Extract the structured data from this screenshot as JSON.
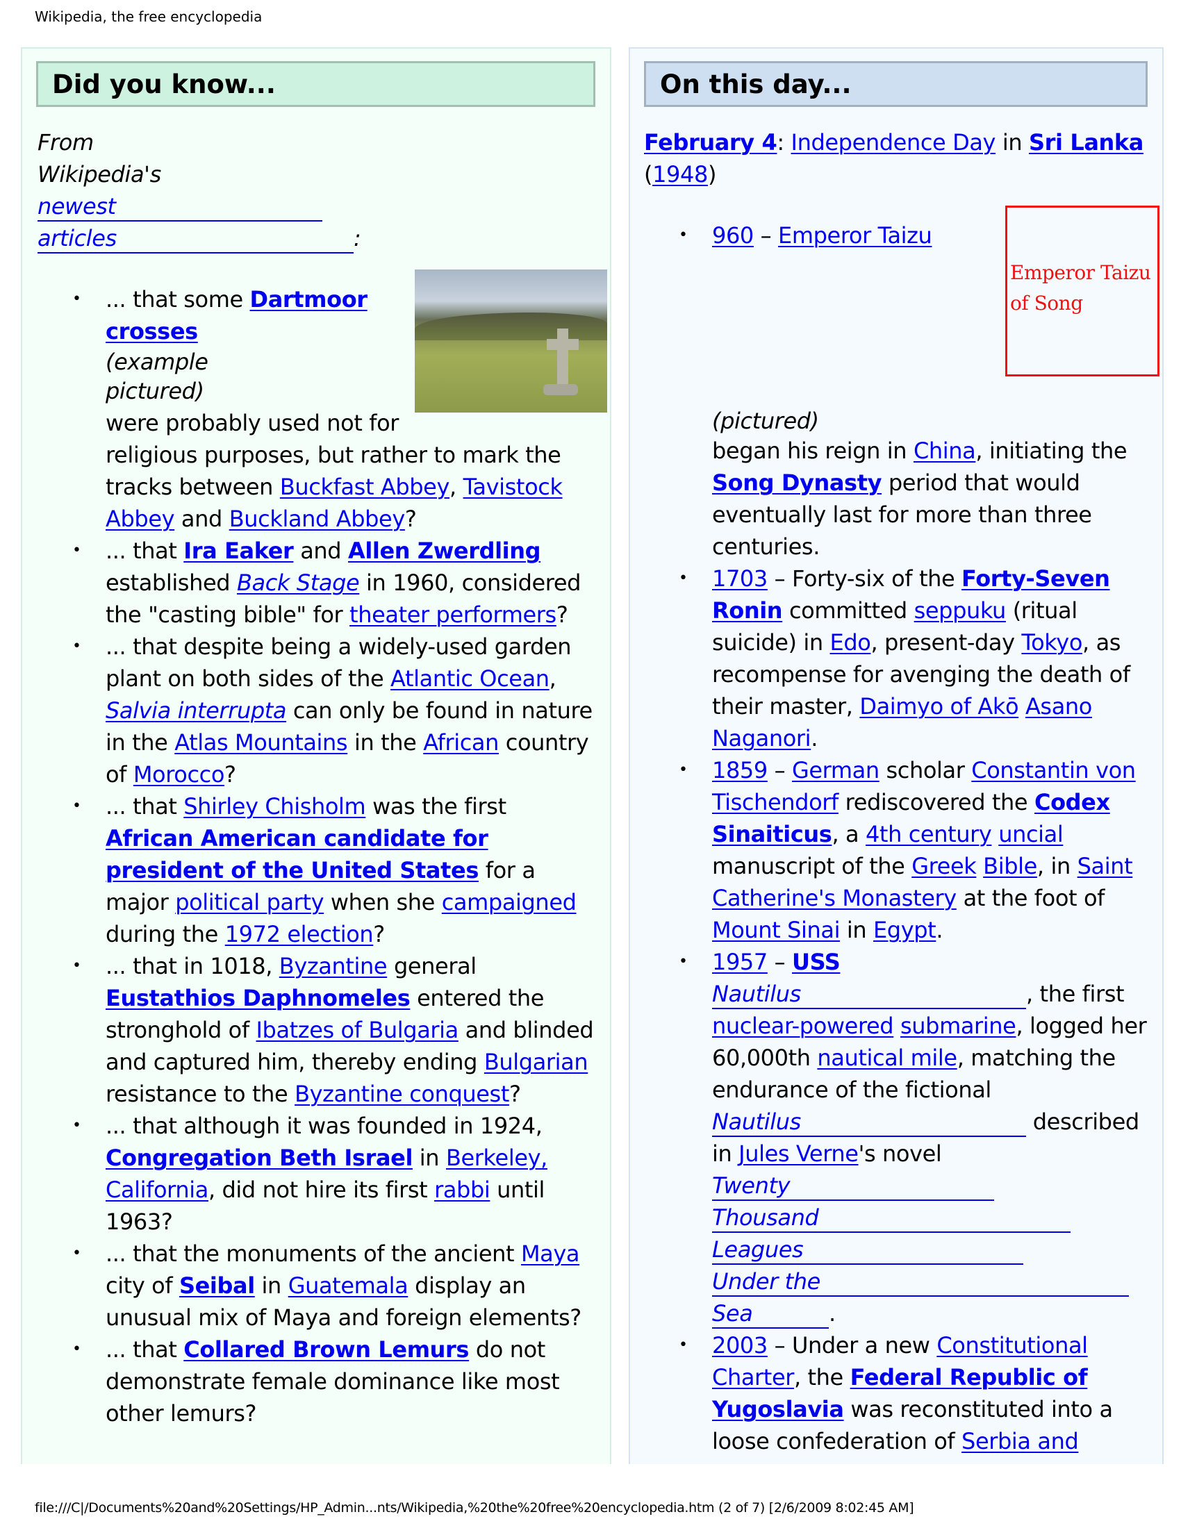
{
  "page_title": "Wikipedia, the free encyclopedia",
  "footer": "file:///C|/Documents%20and%20Settings/HP_Admin...nts/Wikipedia,%20the%20free%20encyclopedia.htm (2 of 7) [2/6/2009 8:02:45 AM]",
  "dyk": {
    "heading": "Did you know...",
    "intro": {
      "from": "From",
      "wikis": "Wikipedia's",
      "newest": "newest",
      "articles": "articles",
      "colon": ":"
    },
    "photo_alt": "Dartmoor cross photo",
    "items": [
      {
        "t": [
          "... that some ",
          "Dartmoor crosses",
          "(example pictured)",
          "were probably used not for religious purposes, but rather to mark the tracks between ",
          "Buckfast Abbey",
          ", ",
          "Tavistock Abbey",
          " and ",
          "Buckland Abbey",
          "?"
        ]
      },
      {
        "t": [
          "... that ",
          "Ira Eaker",
          " and ",
          "Allen Zwerdling",
          " established ",
          "Back Stage",
          " in 1960, considered the \"casting bible\" for ",
          "theater performers",
          "?"
        ]
      },
      {
        "t": [
          "... that despite being a widely-used garden plant on both sides of the ",
          "Atlantic Ocean",
          ", ",
          "Salvia interrupta",
          " can only be found in nature in the ",
          "Atlas Mountains",
          " in the ",
          "African",
          " country of ",
          "Morocco",
          "?"
        ]
      },
      {
        "t": [
          "... that ",
          "Shirley Chisholm",
          " was the first ",
          "African American candidate for president of the United States",
          " for a major ",
          "political party",
          " when she ",
          "campaigned",
          " during the ",
          "1972 election",
          "?"
        ]
      },
      {
        "t": [
          "... that in 1018, ",
          "Byzantine",
          " general ",
          "Eustathios Daphnomeles",
          " entered the stronghold of ",
          "Ibatzes of Bulgaria",
          " and blinded and captured him, thereby ending ",
          "Bulgarian",
          " resistance to the ",
          "Byzantine conquest",
          "?"
        ]
      },
      {
        "t": [
          "... that although it was founded in 1924, ",
          "Congregation Beth Israel",
          " in ",
          "Berkeley, California",
          ", did not hire its first ",
          "rabbi",
          " until 1963?"
        ]
      },
      {
        "t": [
          "... that the monuments of the ancient ",
          "Maya",
          " city of ",
          "Seibal",
          " in ",
          "Guatemala",
          " display an unusual mix of Maya and foreign elements?"
        ]
      },
      {
        "t": [
          "... that ",
          "Collared Brown Lemurs",
          " do not demonstrate female dominance like most other lemurs?"
        ]
      }
    ]
  },
  "otd": {
    "heading": "On this day...",
    "date_link": "February 4",
    "colon": ": ",
    "holiday": "Independence Day",
    "in": " in ",
    "country": "Sri Lanka",
    "year_open": "(",
    "year": "1948",
    "year_close": ")",
    "image_placeholder": "Emperor Taizu of Song",
    "items": [
      {
        "t": [
          "960",
          " – ",
          "Emperor Taizu",
          "(pictured)",
          "began his reign in ",
          "China",
          ", initiating the ",
          "Song Dynasty",
          " period that would eventually last for more than three centuries."
        ]
      },
      {
        "t": [
          "1703",
          " – Forty-six of the ",
          "Forty-Seven Ronin",
          " committed ",
          "seppuku",
          " (ritual suicide) in ",
          "Edo",
          ", present-day ",
          "Tokyo",
          ", as recompense for avenging the death of their master, ",
          "Daimyo of Akō",
          " ",
          "Asano Naganori",
          "."
        ]
      },
      {
        "t": [
          "1859",
          " – ",
          "German",
          " scholar ",
          "Constantin von Tischendorf",
          " rediscovered the ",
          "Codex Sinaiticus",
          ", a ",
          "4th century",
          " ",
          "uncial",
          " manuscript of the ",
          "Greek",
          " ",
          "Bible",
          ", in ",
          "Saint Catherine's Monastery",
          " at the foot of ",
          "Mount Sinai",
          " in ",
          "Egypt",
          "."
        ]
      },
      {
        "t": [
          "1957",
          " – ",
          "USS",
          "Nautilus",
          ", the first ",
          "nuclear-powered",
          " ",
          "submarine",
          ", logged her 60,000th ",
          "nautical mile",
          ", matching the endurance of the fictional ",
          "Nautilus",
          " described in ",
          "Jules Verne",
          "'s novel ",
          "Twenty",
          "Thousand",
          "Leagues",
          "Under the",
          "Sea",
          "."
        ]
      },
      {
        "t": [
          "2003",
          " – Under a new ",
          "Constitutional Charter",
          ", the ",
          "Federal Republic of Yugoslavia",
          " was reconstituted into a loose confederation of ",
          "Serbia and"
        ]
      }
    ]
  }
}
